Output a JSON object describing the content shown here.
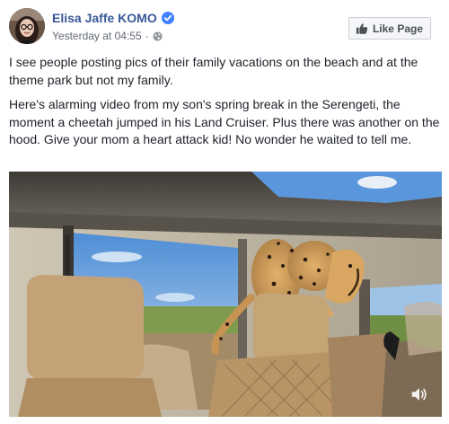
{
  "post": {
    "author": "Elisa Jaffe KOMO",
    "timestamp": "Yesterday at 04:55",
    "separator": "·",
    "verified": true,
    "privacy_icon": "globe-icon",
    "like_page_label": "Like Page",
    "paragraphs": [
      "I see people posting pics of their family vacations on the beach and at the theme park but not my family.",
      "Here's alarming video from my son's spring break in the Serengeti, the moment a cheetah jumped in his Land Cruiser. Plus there was another on the hood. Give your mom a heart attack kid! No wonder he waited to tell me."
    ]
  },
  "video": {
    "description_icon": "video-frame",
    "volume_icon": "volume-icon"
  },
  "colors": {
    "link_blue": "#385898",
    "verified_blue": "#4080ff",
    "meta_gray": "#616770"
  }
}
